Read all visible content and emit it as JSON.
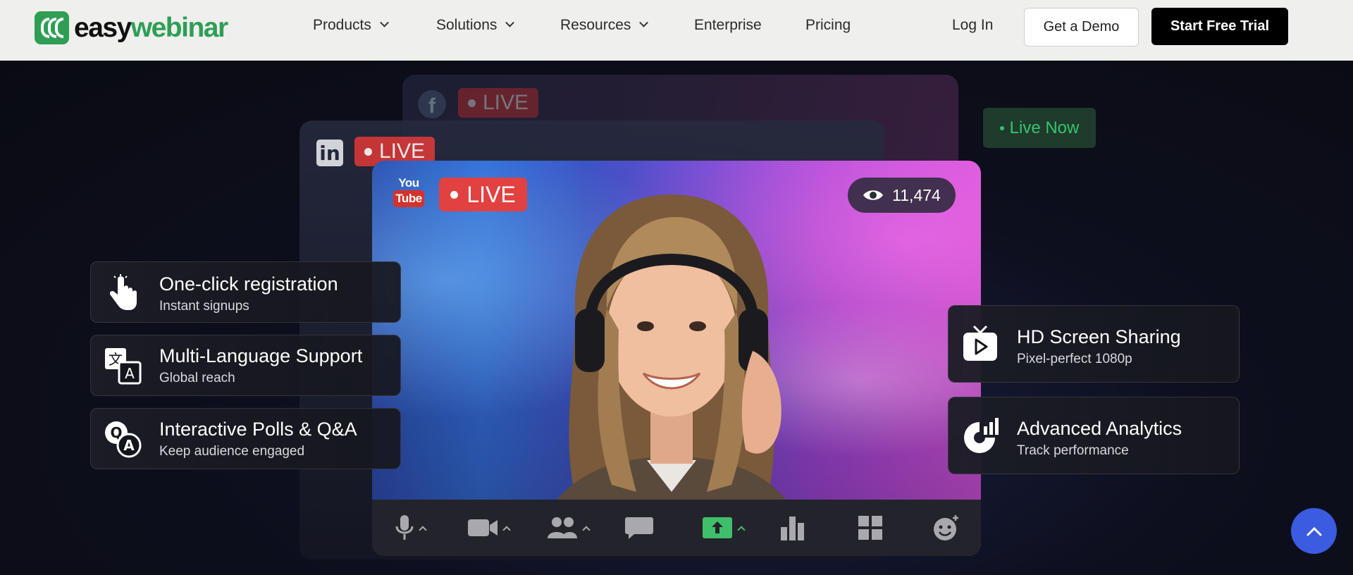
{
  "brand": {
    "name_part1": "easy",
    "name_part2": "webinar",
    "accent": "#2f9e55"
  },
  "nav": {
    "items": [
      {
        "label": "Products",
        "dropdown": true
      },
      {
        "label": "Solutions",
        "dropdown": true
      },
      {
        "label": "Resources",
        "dropdown": true
      },
      {
        "label": "Enterprise",
        "dropdown": false
      },
      {
        "label": "Pricing",
        "dropdown": false
      }
    ],
    "login": "Log In",
    "demo": "Get a Demo",
    "trial": "Start Free Trial"
  },
  "hero": {
    "live_label": "LIVE",
    "viewer_count": "11,474",
    "live_now": "Live Now",
    "youtube": {
      "top": "You",
      "bottom": "Tube"
    },
    "linkedin": "in",
    "features_left": [
      {
        "title": "One-click registration",
        "subtitle": "Instant signups",
        "icon": "pointer-hand-icon"
      },
      {
        "title": "Multi-Language Support",
        "subtitle": "Global reach",
        "icon": "translate-icon"
      },
      {
        "title": "Interactive Polls & Q&A",
        "subtitle": "Keep audience engaged",
        "icon": "qa-bubbles-icon"
      }
    ],
    "features_right": [
      {
        "title": "HD Screen Sharing",
        "subtitle": "Pixel-perfect 1080p",
        "icon": "tv-play-icon"
      },
      {
        "title": "Advanced Analytics",
        "subtitle": "Track performance",
        "icon": "analytics-icon"
      }
    ],
    "toolbar": [
      "microphone-icon",
      "camera-icon",
      "participants-icon",
      "chat-icon",
      "share-screen-icon",
      "poll-chart-icon",
      "grid-layout-icon",
      "reaction-icon"
    ],
    "colors": {
      "live_red": "#e24141",
      "share_green": "#3fbf6a",
      "scroll_button": "#3b5be0"
    }
  }
}
